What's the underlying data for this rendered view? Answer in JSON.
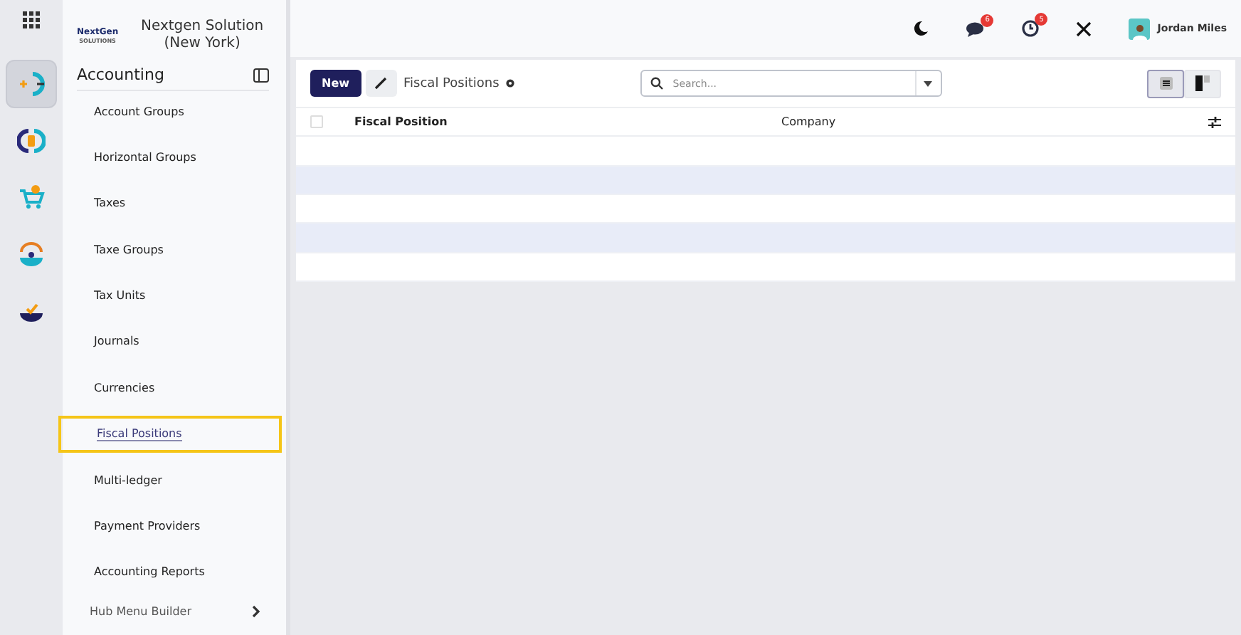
{
  "company": {
    "logo_text": "NextGen",
    "logo_subtext": "SOLUTIONS",
    "name": "Nextgen Solution (New York)"
  },
  "rail": {
    "apps": [
      {
        "kind": "accounting",
        "selected": true
      },
      {
        "kind": "invoicing",
        "selected": false
      },
      {
        "kind": "sales",
        "selected": false
      },
      {
        "kind": "contacts",
        "selected": false
      },
      {
        "kind": "inventory",
        "selected": false
      }
    ]
  },
  "sidebar": {
    "title": "Accounting",
    "items": [
      {
        "label": "Account Groups",
        "selected": false
      },
      {
        "label": "Horizontal Groups",
        "selected": false
      },
      {
        "label": "Taxes",
        "selected": false
      },
      {
        "label": "Taxe Groups",
        "selected": false
      },
      {
        "label": "Tax Units",
        "selected": false
      },
      {
        "label": "Journals",
        "selected": false
      },
      {
        "label": "Currencies",
        "selected": false
      },
      {
        "label": "Fiscal Positions",
        "selected": true
      },
      {
        "label": "Multi-ledger",
        "selected": false
      },
      {
        "label": "Payment Providers",
        "selected": false
      },
      {
        "label": "Accounting Reports",
        "selected": false
      }
    ],
    "footer": "Hub Menu Builder"
  },
  "topbar": {
    "messages_count": "6",
    "activities_count": "5",
    "user": "Jordan Miles"
  },
  "control_panel": {
    "new_button": "New",
    "breadcrumb": "Fiscal Positions",
    "search": {
      "placeholder": "Search..."
    },
    "views": [
      {
        "kind": "list",
        "selected": true
      },
      {
        "kind": "kanban",
        "selected": false
      }
    ]
  },
  "table": {
    "select_all": {
      "checked": false
    },
    "columns": [
      "Fiscal Position",
      "Company"
    ]
  }
}
